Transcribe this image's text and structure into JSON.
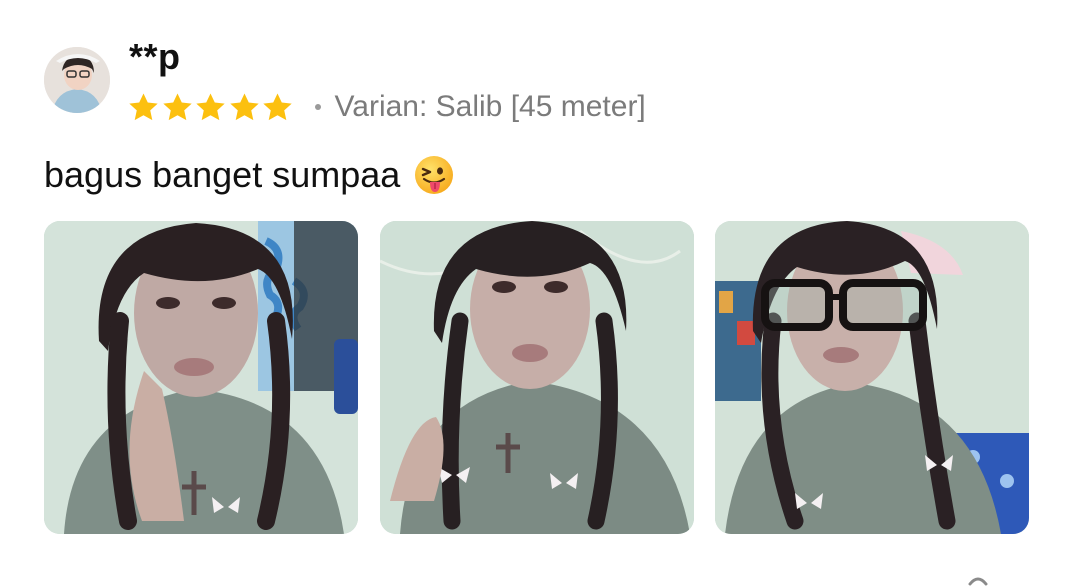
{
  "review": {
    "username": "**p",
    "rating": 5,
    "rating_max": 5,
    "variant": "Varian: Salib [45 meter]",
    "text": "bagus banget sumpaa",
    "emoji": "squinting-face-with-tongue",
    "photos": [
      {
        "icon": "review-photo-selfie"
      },
      {
        "icon": "review-photo-selfie"
      },
      {
        "icon": "review-photo-selfie-glasses"
      }
    ]
  },
  "colors": {
    "star": "#fcc00f",
    "text": "#111111",
    "muted": "#7b7b7b",
    "background": "#ffffff"
  }
}
